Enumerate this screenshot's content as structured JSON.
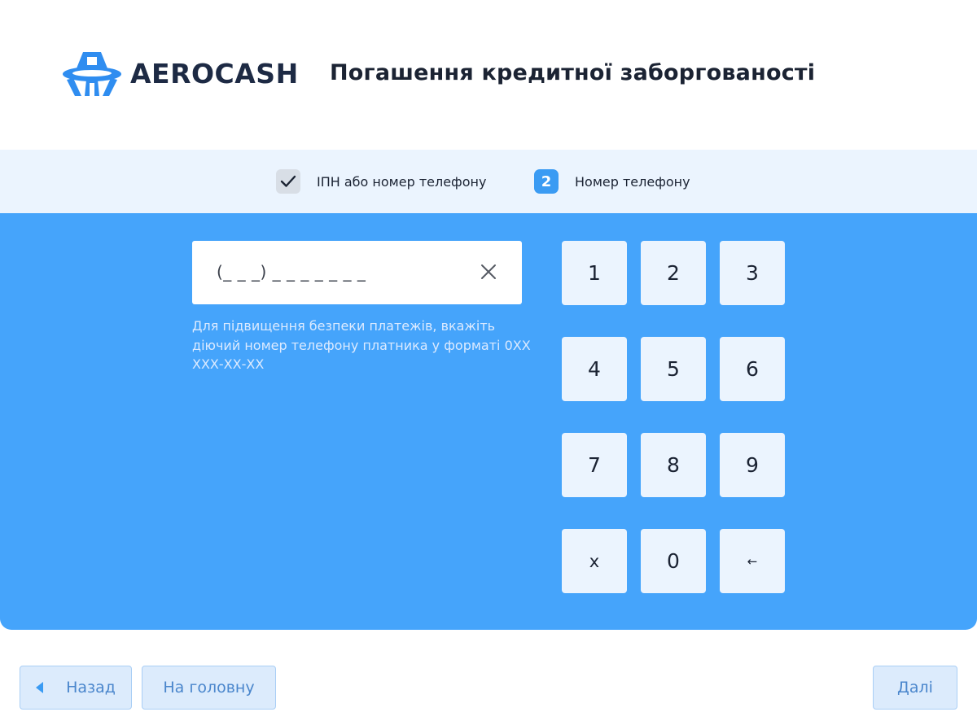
{
  "header": {
    "logo_text": "AEROCASH",
    "page_title": "Погашення кредитної заборгованості"
  },
  "steps": [
    {
      "label": "ІПН або номер телефону",
      "status": "done",
      "icon": "check-icon"
    },
    {
      "label": "Номер телефону",
      "status": "current",
      "number": "2"
    }
  ],
  "phone_input": {
    "value": "(_ _ _)  _ _ _  _ _  _ _",
    "clear_icon": "close-icon"
  },
  "hint": "Для підвищення безпеки платежів, вкажіть діючий номер телефону платника у форматі 0ХХ ХХХ-ХХ-ХХ",
  "keypad": {
    "keys": [
      "1",
      "2",
      "3",
      "4",
      "5",
      "6",
      "7",
      "8",
      "9",
      "x",
      "0",
      "←"
    ]
  },
  "nav": {
    "back_label": "Назад",
    "home_label": "На головну",
    "next_label": "Далі"
  },
  "colors": {
    "accent": "#45a4fb",
    "badge": "#3a9bf3",
    "steps_bar": "#ebf4fe",
    "key_bg": "#ebf4fe",
    "button_bg": "#dcebfc",
    "button_text": "#4a86cc"
  }
}
